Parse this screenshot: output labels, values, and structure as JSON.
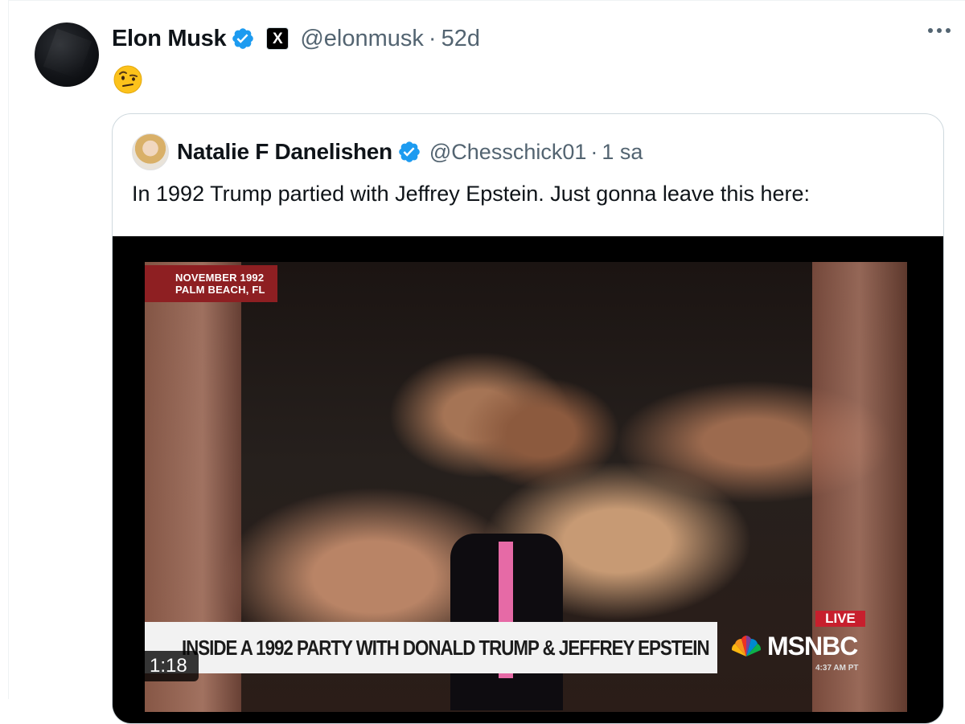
{
  "tweet": {
    "author_name": "Elon Musk",
    "handle": "@elonmusk",
    "separator": "·",
    "time": "52d",
    "emoji": "face-with-raised-eyebrow",
    "affiliation_badge": "X"
  },
  "quote": {
    "author_name": "Natalie F Danelishen",
    "handle": "@Chesschick01",
    "separator": "·",
    "time": "1 sa",
    "text": "In 1992 Trump partied with Jeffrey Epstein. Just gonna leave this here:",
    "video": {
      "date_tag_line1": "NOVEMBER 1992",
      "date_tag_line2": "PALM BEACH, FL",
      "headline": "INSIDE A 1992 PARTY WITH DONALD TRUMP & JEFFREY EPSTEIN",
      "live_label": "LIVE",
      "network": "MSNBC",
      "clock": "4:37 AM PT",
      "duration": "1:18"
    }
  },
  "colors": {
    "verified_blue": "#1d9bf0",
    "secondary_text": "#536471",
    "border": "#cfd9de"
  }
}
